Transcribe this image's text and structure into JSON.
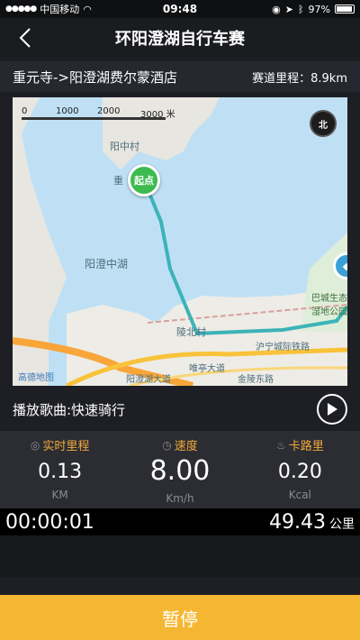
{
  "status_bar": {
    "carrier": "中国移动",
    "time": "09:48",
    "battery": "97%"
  },
  "nav": {
    "title": "环阳澄湖自行车赛"
  },
  "route": {
    "name": "重元寺->阳澄湖费尔蒙酒店",
    "distance": "赛道里程：8.9km"
  },
  "map": {
    "scale_labels": [
      "0",
      "1000",
      "2000",
      "3000 米"
    ],
    "compass": "北",
    "start_label": "起点",
    "places": [
      "阳中村",
      "阳澄中湖",
      "重",
      "陵北村",
      "巴城生态湿地公园",
      "阳澄湖大道",
      "沪宁城际铁路",
      "金陵东路",
      "唯亭大道",
      "高德地图"
    ]
  },
  "music": {
    "label": "播放歌曲:快速骑行"
  },
  "stats": [
    {
      "label": "实时里程",
      "value": "0.13",
      "unit": "KM"
    },
    {
      "label": "速度",
      "value": "8.00",
      "unit": "Km/h"
    },
    {
      "label": "卡路里",
      "value": "0.20",
      "unit": "Kcal"
    }
  ],
  "timer": {
    "elapsed": "00:00:01",
    "total": "49.43",
    "total_unit": "公里"
  },
  "pause_button": "暂停",
  "colors": {
    "accent": "#f5b731",
    "stat_label": "#f2a93b",
    "route": "#3bb3b8"
  }
}
